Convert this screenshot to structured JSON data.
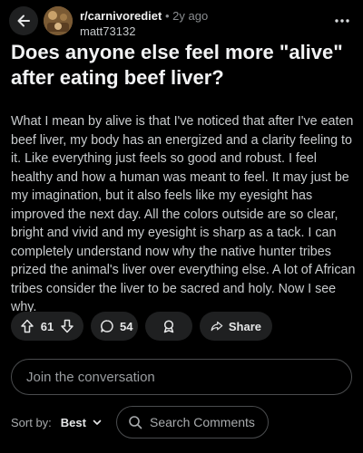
{
  "header": {
    "subreddit": "r/carnivorediet",
    "separator": "•",
    "age": "2y ago",
    "author": "matt73132"
  },
  "post": {
    "title": "Does anyone else feel more \"alive\" after eating beef liver?",
    "body": "What I mean by alive is that I've noticed that after I've eaten beef liver, my body has an energized and a clarity feeling to it. Like everything just feels so good and robust. I feel healthy and how a human was meant to feel. It may just be my imagination, but it also feels like my eyesight has improved the next day. All the colors outside are so clear, bright and vivid and my eyesight is sharp as a tack. I can completely understand now why the native hunter tribes prized the animal's liver over everything else. A lot of African tribes consider the liver to be sacred and holy. Now I see why."
  },
  "actions": {
    "vote_count": "61",
    "comment_count": "54",
    "share_label": "Share"
  },
  "comments": {
    "join_placeholder": "Join the conversation",
    "sort_label": "Sort by:",
    "sort_value": "Best",
    "search_label": "Search Comments"
  },
  "icons": {
    "back": "back-arrow-icon",
    "more": "more-options-icon",
    "upvote": "upvote-arrow-icon",
    "downvote": "downvote-arrow-icon",
    "comment": "comment-bubble-icon",
    "award": "award-icon",
    "share": "share-arrow-icon",
    "sort": "chevron-down-icon",
    "search": "search-icon"
  },
  "colors": {
    "background": "#000000",
    "pill": "#1f2021",
    "text": "#d7dadc",
    "muted": "#8a8d90"
  }
}
